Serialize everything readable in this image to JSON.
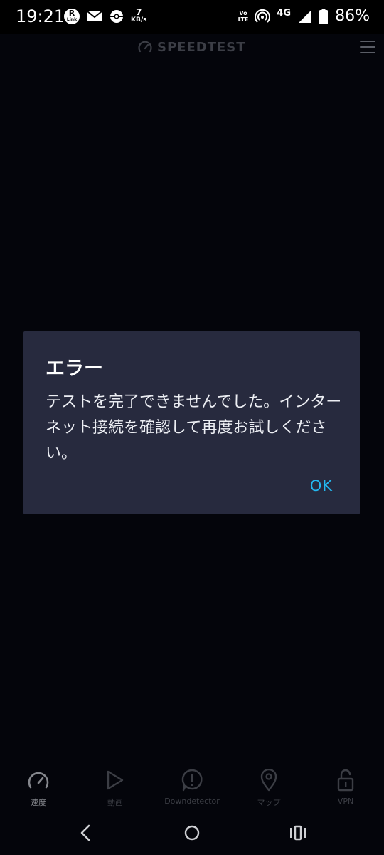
{
  "status_bar": {
    "time": "19:21",
    "r_badge": "R",
    "r_sub": "Link",
    "data_rate_value": "7",
    "data_rate_unit": "KB/s",
    "volte_top": "Vo",
    "volte_bottom": "LTE",
    "network": "4G",
    "battery": "86%"
  },
  "app": {
    "logo_text": "SPEEDTEST"
  },
  "dialog": {
    "title": "エラー",
    "message": "テストを完了できませんでした。インターネット接続を確認して再度お試しください。",
    "ok_label": "OK"
  },
  "bottom_nav": {
    "items": [
      {
        "label": "速度",
        "icon": "speedometer-icon",
        "active": true
      },
      {
        "label": "動画",
        "icon": "play-icon",
        "active": false
      },
      {
        "label": "Downdetector",
        "icon": "alert-bubble-icon",
        "active": false
      },
      {
        "label": "マップ",
        "icon": "map-pin-icon",
        "active": false
      },
      {
        "label": "VPN",
        "icon": "unlock-icon",
        "active": false
      }
    ]
  },
  "colors": {
    "background": "#04050b",
    "dialog_bg": "#272a3e",
    "accent": "#23b8f0"
  }
}
